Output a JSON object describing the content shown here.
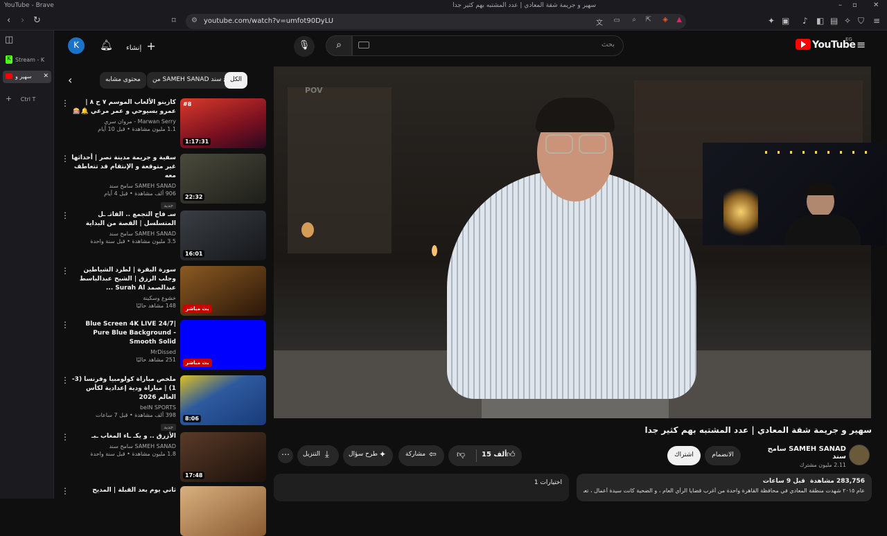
{
  "browser": {
    "window_title": "YouTube - Brave",
    "tab_title": "سهير و جريمة شقة المعادي | عدد المشتبه بهم كثير جدا",
    "url": "youtube.com/watch?v=umfot90DyLU",
    "tabs": [
      {
        "label": "Stream - K"
      },
      {
        "label": "سهير و"
      },
      {
        "label": "Ctrl T"
      }
    ]
  },
  "yt_header": {
    "logo_text": "YouTube",
    "region": "EG",
    "search_placeholder": "بحث",
    "create_label": "إنشاء",
    "avatar_letter": "K"
  },
  "chips": [
    {
      "label": "الكل",
      "active": true
    },
    {
      "label": "من SAMEH SANAD سامح سند",
      "active": false
    },
    {
      "label": "محتوى مشابه",
      "active": false
    }
  ],
  "recommendations": [
    {
      "title": "كازينو الألعاب الموسم ٧ ح ٨ | عمرو بسيوحي و عمر مرعي 🔔🎰",
      "channel": "Marwan Serry - مروان سري",
      "stats": "1.1 مليون مشاهدة • قبل 10 أيام",
      "duration": "1:17:31",
      "badge": "",
      "thumb_color": "#b5202a"
    },
    {
      "title": "سفية و جريمة مدينة نصر | أحداثها غير متوقعة و الإنتقام قد تتعاطف معه",
      "channel": "SAMEH SANAD سامح سند",
      "stats": "906 ألف مشاهدة • قبل 4 أيام",
      "duration": "22:32",
      "badge": "جديد",
      "thumb_color": "#3a3a30"
    },
    {
      "title": "سـ فاح التجمع .. الفاتـ ـل المتسلسل | القصة من البداية",
      "channel": "SAMEH SANAD سامح سند",
      "stats": "3.5 مليون مشاهدة • قبل سنة واحدة",
      "duration": "16:01",
      "badge": "",
      "thumb_color": "#2b2e33"
    },
    {
      "title": "سورة البقرة | لطرد الشياطين وجلب الرزق | الشيخ عبدالباسط عبدالصمد Surah Al ...",
      "channel": "خشوع وسكينة",
      "stats": "148 مشاهد حاليًا",
      "duration": "",
      "badge": "بث مباشر",
      "thumb_color": "#7a4b1a"
    },
    {
      "title": "Blue Screen 4K LIVE 24/7| Pure Blue Background - Smooth Solid",
      "channel": "MrDissed",
      "stats": "251 مشاهد حاليًا",
      "duration": "",
      "badge": "بث مباشر",
      "thumb_color": "#0000ff"
    },
    {
      "title": "ملخص مباراة كولومبيا وفرنسا (3-1) | مباراة ودية إعدادية لكأس العالم 2026",
      "channel": "beIN SPORTS",
      "stats": "398 ألف مشاهدة • قبل 7 ساعات",
      "duration": "8:06",
      "badge": "جديد",
      "thumb_color": "#2d5a9e"
    },
    {
      "title": "الأزرق .. و يكـ ـاء المغاب ـبـ",
      "channel": "SAMEH SANAD سامح سند",
      "stats": "1.8 مليون مشاهدة • قبل سنة واحدة",
      "duration": "17:48",
      "badge": "",
      "thumb_color": "#3b2a20"
    },
    {
      "title": "ثاني يوم بعد القبلة | المديح",
      "channel": "",
      "stats": "",
      "duration": "",
      "badge": "",
      "thumb_color": "#c8a070"
    }
  ],
  "player": {
    "overlay_text": "POV"
  },
  "video": {
    "title": "سهير و جريمة شقة المعادي | عدد المشتبه بهم كثير جدا",
    "channel_name": "SAMEH SANAD سامح سند",
    "subscribers": "2.11 مليون مشترك",
    "join_label": "الانضمام",
    "subscribe_label": "اشتراك",
    "likes": "15 ألف",
    "share_label": "مشاركة",
    "ask_label": "طرح سؤال",
    "download_label": "التنزيل",
    "views": "283,756",
    "views_label": "مشاهدة",
    "upload_time": "قبل 9 ساعات",
    "description_snippet": "عام ٢٠١٥ شهدت منطقة المعادي في محافظة القاهرة واحدة من أغرب قضايا الرأي العام ، و الضحية كانت سيدة أعمال ، تعمل",
    "comments_label": "اختيارات 1"
  }
}
